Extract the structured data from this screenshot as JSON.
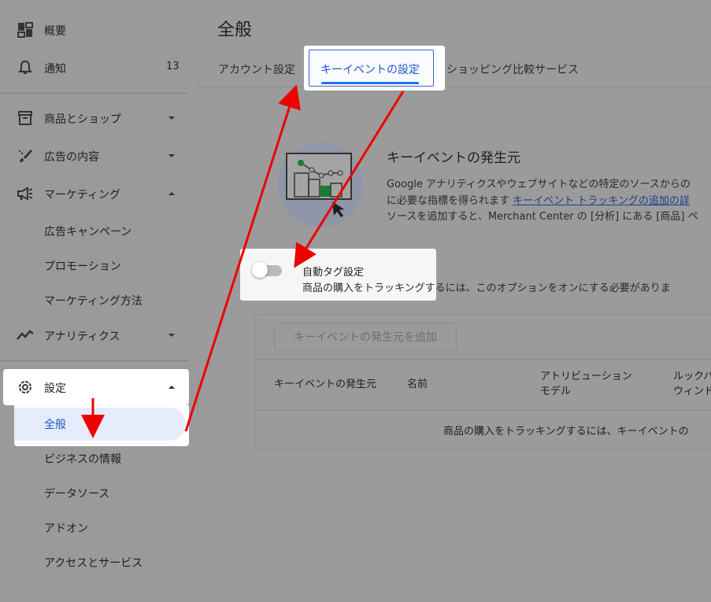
{
  "sidebar": {
    "items": [
      {
        "label": "概要",
        "icon": "dashboard-icon"
      },
      {
        "label": "通知",
        "icon": "bell-icon",
        "count": "13"
      },
      {
        "label": "商品とショップ",
        "icon": "store-icon"
      },
      {
        "label": "広告の内容",
        "icon": "brush-icon"
      },
      {
        "label": "マーケティング",
        "icon": "megaphone-icon"
      },
      {
        "label": "アナリティクス",
        "icon": "trend-icon"
      },
      {
        "label": "設定",
        "icon": "gear-icon"
      }
    ],
    "marketing_sub": [
      "広告キャンペーン",
      "プロモーション",
      "マーケティング方法"
    ],
    "settings_sub": [
      "全般",
      "ビジネスの情報",
      "データソース",
      "アドオン",
      "アクセスとサービス"
    ]
  },
  "main": {
    "title": "全般",
    "tabs": [
      "アカウント設定",
      "キーイベントの設定",
      "ショッピング比較サービス"
    ],
    "active_tab": "キーイベントの設定",
    "section_title": "キーイベントの発生元",
    "desc_line1": "Google アナリティクスやウェブサイトなどの特定のソースからの",
    "desc_line2_pre": "に必要な指標を得られます ",
    "desc_link": "キーイベント トラッキングの追加の詳",
    "desc_line3": "ソースを追加すると、Merchant Center の [分析] にある [商品] ペ",
    "toggle_title": "自動タグ設定",
    "toggle_sub": "商品の購入をトラッキングするには、このオプションをオンにする必要がありま",
    "toggle_on": false,
    "add_button": "キーイベントの発生元を追加",
    "table_headers": [
      "キーイベントの発生元",
      "名前",
      "アトリビューション\nモデル",
      "ルックバ\nウィンド"
    ],
    "empty_message": "商品の購入をトラッキングするには、キーイベントの"
  },
  "colors": {
    "accent": "#1a73e8",
    "annotation_arrow": "#ee0000",
    "dim_background": "#9b9b9b"
  }
}
